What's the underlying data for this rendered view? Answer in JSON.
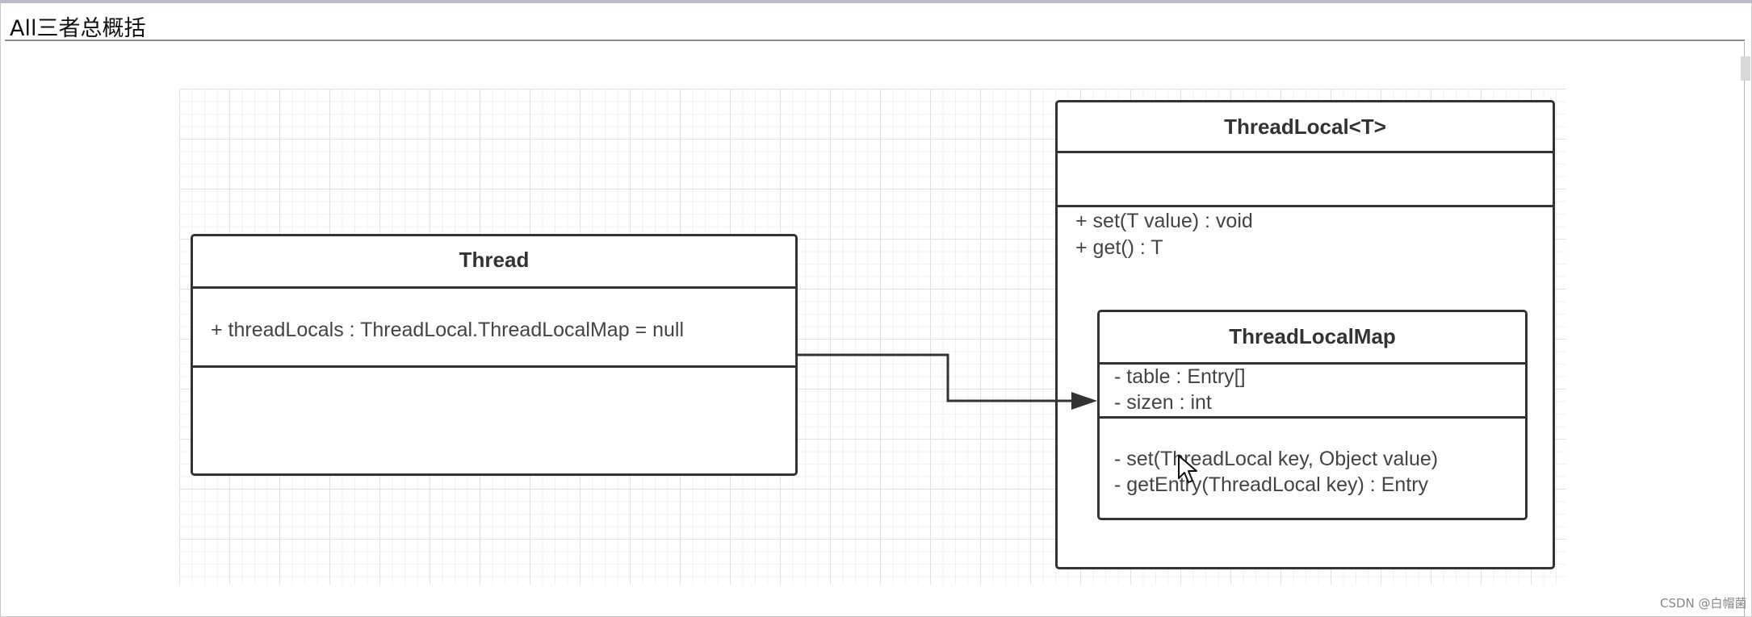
{
  "window": {
    "title": "All三者总概括"
  },
  "diagram": {
    "thread": {
      "name": "Thread",
      "attributes": [
        "+ threadLocals : ThreadLocal.ThreadLocalMap = null"
      ],
      "methods": []
    },
    "thread_local": {
      "name": "ThreadLocal<T>",
      "attributes": [],
      "methods": [
        "+ set(T value) : void",
        "+ get() : T"
      ]
    },
    "thread_local_map": {
      "name": "ThreadLocalMap",
      "attributes": [
        "- table : Entry[]",
        "- sizen : int"
      ],
      "methods": [
        "- set(ThreadLocal key, Object value)",
        "- getEntry(ThreadLocal key) :  Entry"
      ]
    }
  },
  "watermark": "CSDN @白帽菌",
  "colors": {
    "stroke": "#333333",
    "grid": "#e1e1e1",
    "text": "#444444"
  },
  "icons": {
    "cursor": "mouse-pointer-icon"
  }
}
